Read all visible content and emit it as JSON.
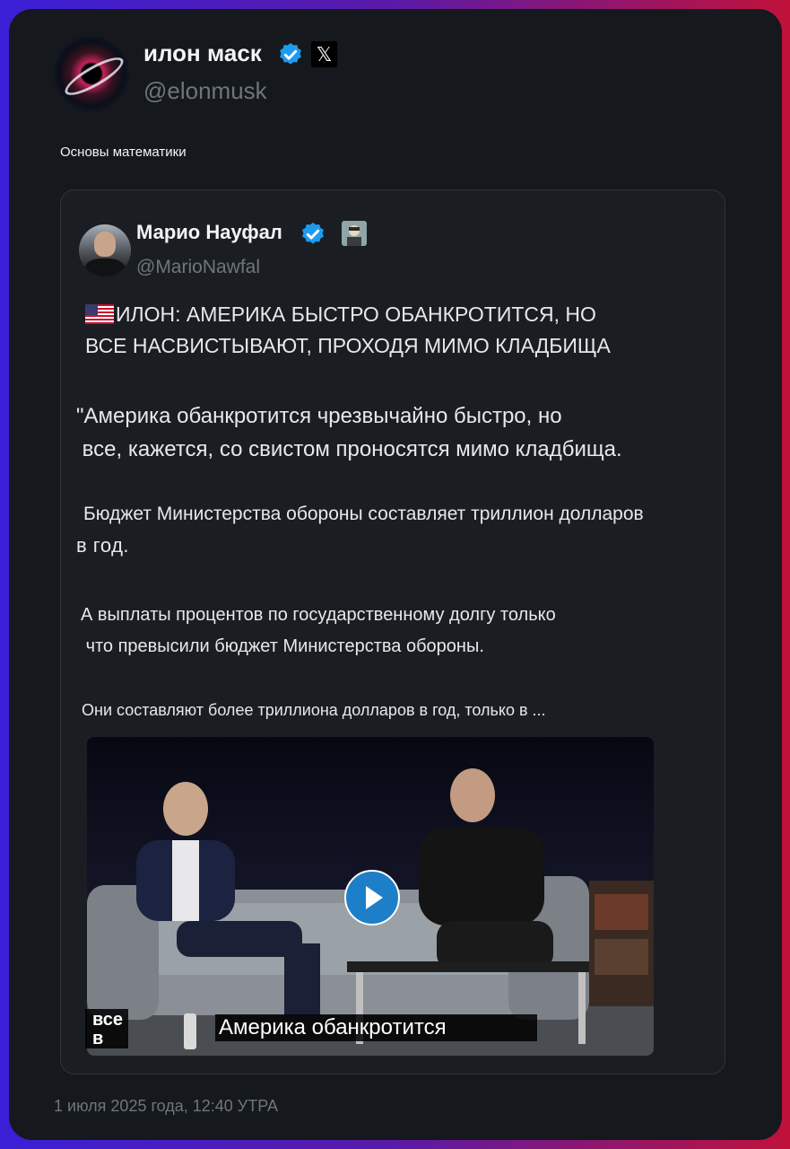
{
  "author": {
    "name": "илон маск",
    "handle": "@elonmusk",
    "avatar_icon": "black-hole-avatar",
    "verified_icon": "verified-badge-icon",
    "affiliate_icon": "x-logo-icon"
  },
  "tweet": {
    "text": "Основы математики"
  },
  "quoted_tweet": {
    "author": {
      "name": "Марио Науфал",
      "handle": "@MarioNawfal",
      "verified_icon": "verified-badge-icon",
      "badge_icon": "profile-badge-icon"
    },
    "headline_line1": "ИЛОН: АМЕРИКА БЫСТРО ОБАНКРОТИТСЯ, НО",
    "headline_line2": "ВСЕ НАСВИСТЫВАЮТ, ПРОХОДЯ МИМО КЛАДБИЩА",
    "quote_line1": "\"Америка обанкротится чрезвычайно быстро, но",
    "quote_line2": "все, кажется, со свистом проносятся мимо кладбища.",
    "budget_line1": "Бюджет Министерства обороны составляет триллион долларов",
    "budget_line2": "в год.",
    "interest_line1": "А выплаты процентов по государственному долгу только",
    "interest_line2": "что превысили бюджет Министерства обороны.",
    "more_text": "Они составляют более триллиона долларов в год, только в ..."
  },
  "video": {
    "caption_small_line1": "все",
    "caption_small_line2": "в",
    "caption_main": "Америка обанкротится",
    "play_icon": "play-icon"
  },
  "timestamp": "1 июля 2025 года, 12:40 УТРА",
  "colors": {
    "background_left": "#3a1fd6",
    "background_right": "#c0123a",
    "card": "#15181c",
    "verified": "#1d9bf0",
    "muted_text": "#6e767d"
  }
}
